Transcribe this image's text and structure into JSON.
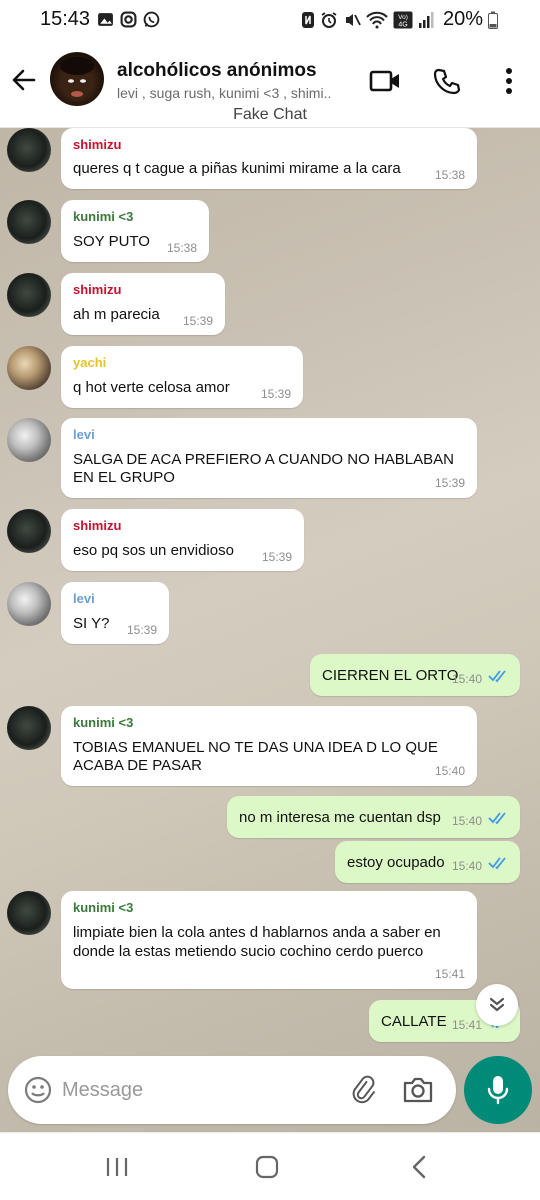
{
  "status_bar": {
    "time": "15:43",
    "battery": "20%",
    "net_top": "Vo)",
    "net_bottom": "4G"
  },
  "header": {
    "title": "alcohólicos anónimos",
    "subtitle": "levi , suga rush, kunimi <3 , shimi..",
    "banner": "Fake Chat"
  },
  "colors": {
    "shimizu": "#c8102e",
    "kunimi": "#3b7a3b",
    "yachi": "#e8c22a",
    "levi": "#6a9fcf",
    "tick": "#3a9be8",
    "mic": "#008a78"
  },
  "messages": [
    {
      "side": "in",
      "sender": "shimizu",
      "text": "queres q t cague a piñas kunimi mirame a la cara",
      "time": "15:38"
    },
    {
      "side": "in",
      "sender": "kunimi <3",
      "text": "SOY PUTO",
      "time": "15:38"
    },
    {
      "side": "in",
      "sender": "shimizu",
      "text": "ah m parecia",
      "time": "15:39"
    },
    {
      "side": "in",
      "sender": "yachi",
      "text": "q hot verte celosa amor",
      "time": "15:39"
    },
    {
      "side": "in",
      "sender": "levi",
      "text_line1": "SALGA DE ACA PREFIERO A CUANDO NO HABLABAN",
      "text_line2": "EN EL GRUPO",
      "time": "15:39"
    },
    {
      "side": "in",
      "sender": "shimizu",
      "text": "eso pq sos un envidioso",
      "time": "15:39"
    },
    {
      "side": "in",
      "sender": "levi",
      "text": "SI Y?",
      "time": "15:39"
    },
    {
      "side": "out",
      "text": "CIERREN EL ORTO",
      "time": "15:40"
    },
    {
      "side": "in",
      "sender": "kunimi <3",
      "text_line1": "TOBIAS EMANUEL NO TE DAS UNA IDEA D LO QUE",
      "text_line2": "ACABA DE PASAR",
      "time": "15:40"
    },
    {
      "side": "out",
      "text": "no m interesa me cuentan dsp",
      "time": "15:40"
    },
    {
      "side": "out",
      "text": "estoy ocupado",
      "time": "15:40"
    },
    {
      "side": "in",
      "sender": "kunimi <3",
      "text_line1": "limpiate bien la cola antes d hablarnos anda a saber en",
      "text_line2": "donde la estas metiendo sucio cochino cerdo puerco",
      "time": "15:41"
    },
    {
      "side": "out",
      "text": "CALLATE",
      "time": "15:41"
    }
  ],
  "composer": {
    "placeholder": "Message"
  }
}
